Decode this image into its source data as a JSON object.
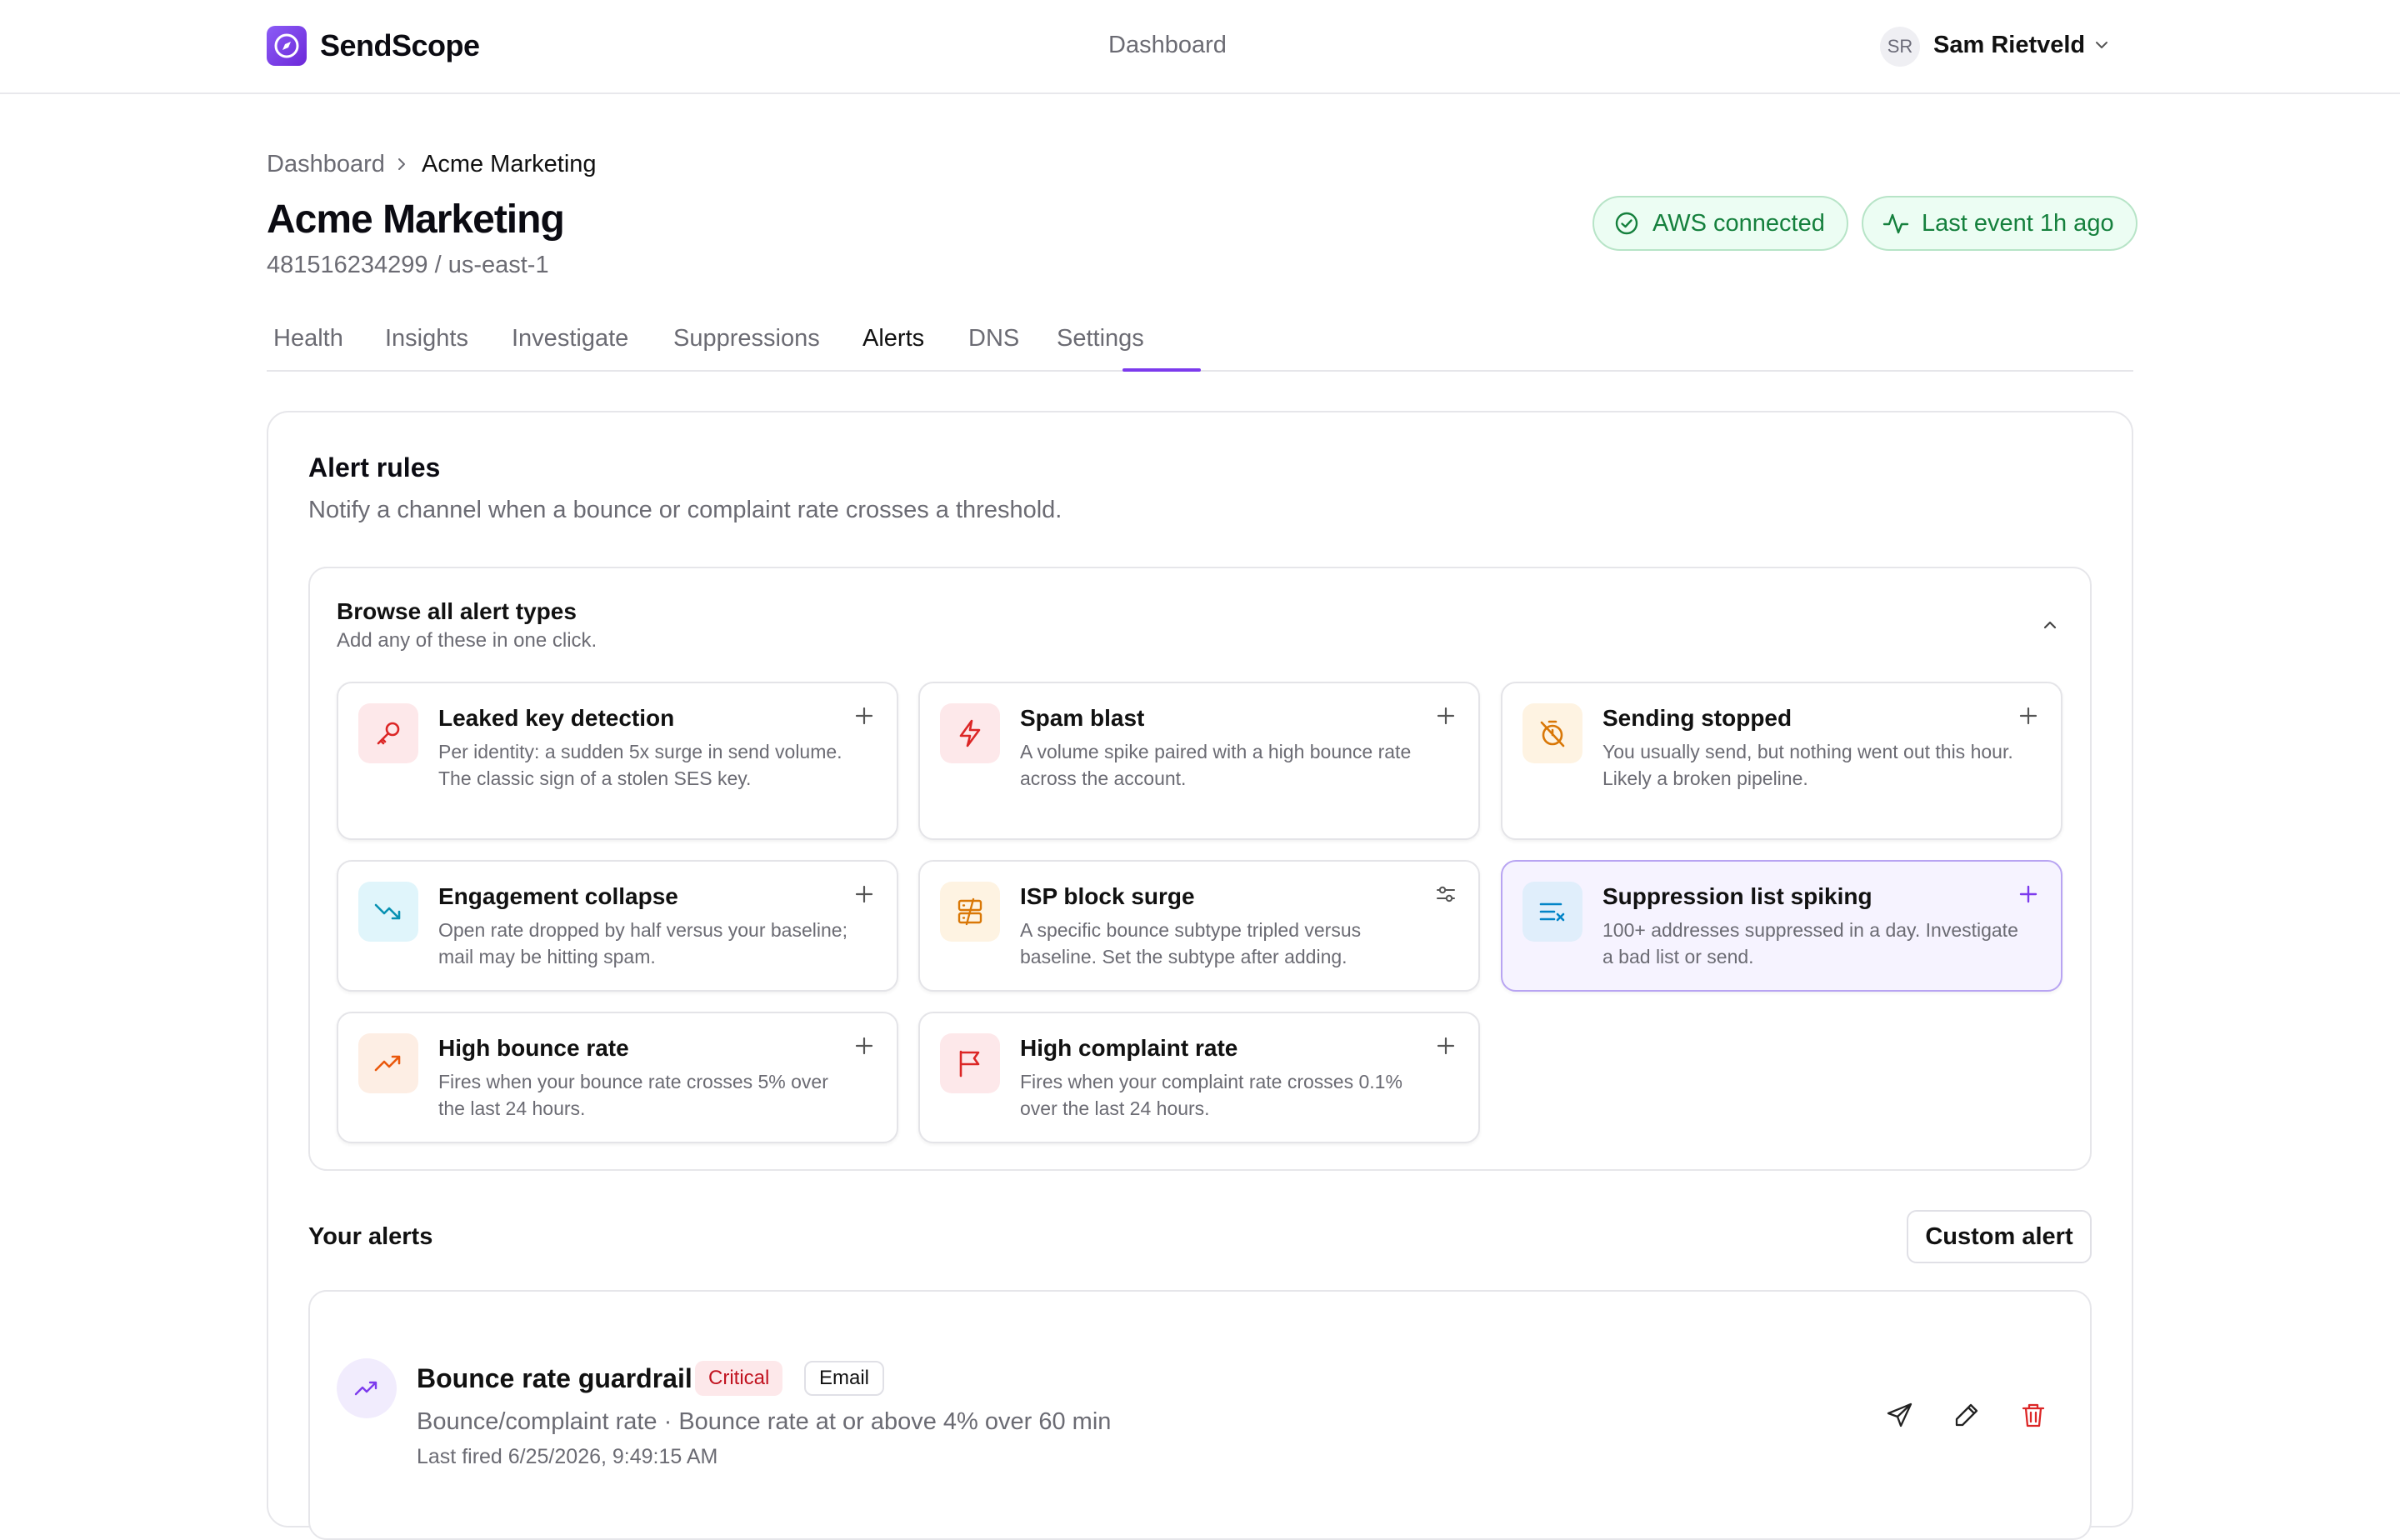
{
  "app": {
    "brand": "SendScope",
    "nav_center": "Dashboard",
    "user_initials": "SR",
    "user_name": "Sam Rietveld"
  },
  "breadcrumb": {
    "items": [
      "Dashboard",
      "Acme Marketing"
    ]
  },
  "page": {
    "title": "Acme Marketing",
    "subtitle": "481516234299 / us-east-1",
    "status_pills": [
      {
        "label": "AWS connected",
        "icon": "check-circle-icon"
      },
      {
        "label": "Last event 1h ago",
        "icon": "activity-icon"
      }
    ]
  },
  "tabs": [
    {
      "label": "Health",
      "active": false
    },
    {
      "label": "Insights",
      "active": false
    },
    {
      "label": "Investigate",
      "active": false
    },
    {
      "label": "Suppressions",
      "active": false
    },
    {
      "label": "Alerts",
      "active": true
    },
    {
      "label": "DNS",
      "active": false
    },
    {
      "label": "Settings",
      "active": false
    }
  ],
  "alert_rules": {
    "title": "Alert rules",
    "description": "Notify a channel when a bounce or complaint rate crosses a threshold."
  },
  "browse": {
    "title": "Browse all alert types",
    "subtitle": "Add any of these in one click.",
    "types": [
      {
        "title": "Leaked key detection",
        "description": "Per identity: a sudden 5x surge in send volume. The classic sign of a stolen SES key.",
        "icon": "key-icon",
        "color": "#dc2626",
        "action_icon": "plus-icon"
      },
      {
        "title": "Spam blast",
        "description": "A volume spike paired with a high bounce rate across the account.",
        "icon": "lightning-icon",
        "color": "#dc2626",
        "action_icon": "plus-icon"
      },
      {
        "title": "Sending stopped",
        "description": "You usually send, but nothing went out this hour. Likely a broken pipeline.",
        "icon": "timer-off-icon",
        "color": "#d97706",
        "action_icon": "plus-icon"
      },
      {
        "title": "Engagement collapse",
        "description": "Open rate dropped by half versus your baseline; mail may be hitting spam.",
        "icon": "trending-down-icon",
        "color": "#0891b2",
        "action_icon": "plus-icon"
      },
      {
        "title": "ISP block surge",
        "description": "A specific bounce subtype tripled versus baseline. Set the subtype after adding.",
        "icon": "server-off-icon",
        "color": "#d97706",
        "action_icon": "sliders-icon"
      },
      {
        "title": "Suppression list spiking",
        "description": "100+ addresses suppressed in a day. Investigate a bad list or send.",
        "icon": "list-x-icon",
        "color": "#0284c7",
        "action_icon": "plus-icon",
        "highlighted": true
      },
      {
        "title": "High bounce rate",
        "description": "Fires when your bounce rate crosses 5% over the last 24 hours.",
        "icon": "trending-up-icon",
        "color": "#ea580c",
        "action_icon": "plus-icon"
      },
      {
        "title": "High complaint rate",
        "description": "Fires when your complaint rate crosses 0.1% over the last 24 hours.",
        "icon": "flag-icon",
        "color": "#dc2626",
        "action_icon": "plus-icon"
      }
    ]
  },
  "your_alerts": {
    "title": "Your alerts",
    "custom_button": "Custom alert",
    "items": [
      {
        "name": "Bounce rate guardrail",
        "severity": "Critical",
        "channel": "Email",
        "description": "Bounce/complaint rate · Bounce rate at or above 4% over 60 min",
        "last_fired": "Last fired 6/25/2026, 9:49:15 AM"
      }
    ]
  },
  "colors": {
    "accent": "#7c3aed",
    "success": "#15803d",
    "danger": "#c1121f"
  }
}
